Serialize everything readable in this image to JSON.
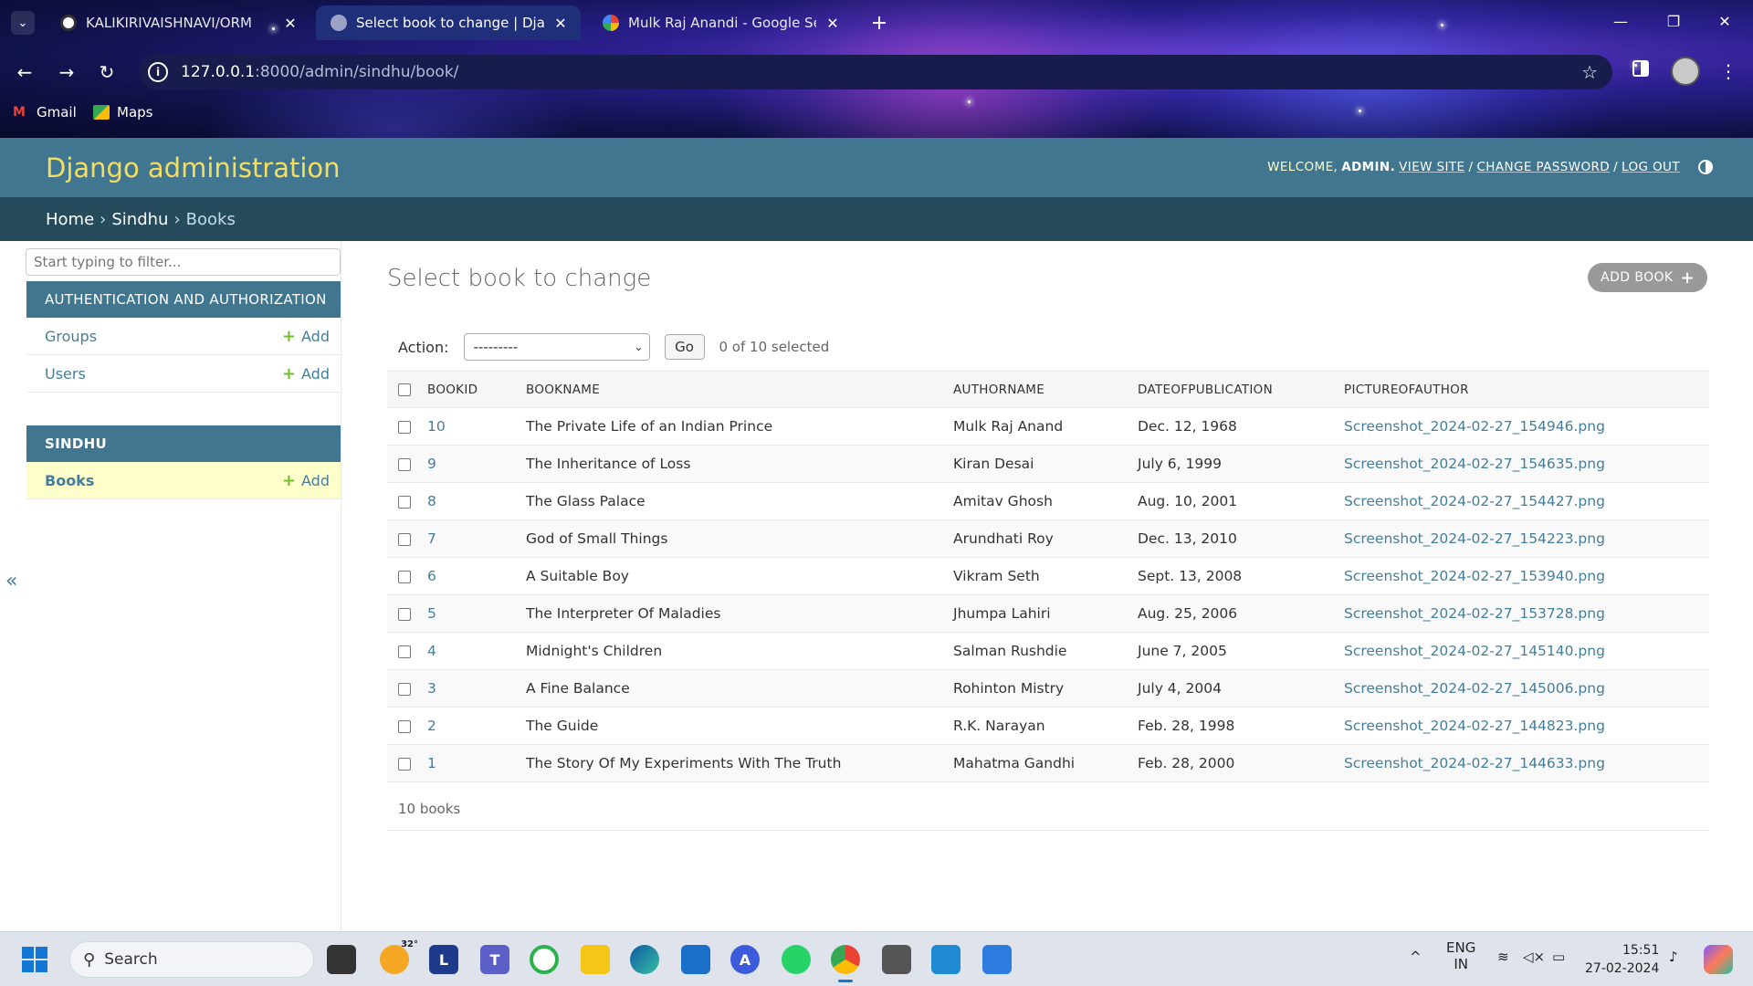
{
  "browser": {
    "tabs": [
      {
        "title": "KALIKIRIVAISHNAVI/ORM",
        "active": false,
        "icon": "github-icon"
      },
      {
        "title": "Select book to change | Django",
        "active": true,
        "icon": "globe-icon"
      },
      {
        "title": "Mulk Raj Anandi - Google Search",
        "active": false,
        "icon": "google-icon"
      }
    ],
    "url_host": "127.0.0.1",
    "url_rest": ":8000/admin/sindhu/book/",
    "bookmarks": [
      {
        "label": "Gmail",
        "icon": "gmail-icon"
      },
      {
        "label": "Maps",
        "icon": "maps-icon"
      }
    ]
  },
  "admin": {
    "branding": "Django administration",
    "welcome": "WELCOME,",
    "user": "ADMIN.",
    "view_site": "VIEW SITE",
    "change_password": "CHANGE PASSWORD",
    "log_out": "LOG OUT",
    "sep": "/",
    "breadcrumbs": [
      "Home",
      "Sindhu",
      "Books"
    ],
    "breadcrumb_sep": "›"
  },
  "sidebar": {
    "filter_placeholder": "Start typing to filter...",
    "apps": [
      {
        "name": "AUTHENTICATION AND AUTHORIZATION",
        "models": [
          {
            "name": "Groups",
            "add": "Add"
          },
          {
            "name": "Users",
            "add": "Add"
          }
        ]
      },
      {
        "name": "SINDHU",
        "models": [
          {
            "name": "Books",
            "add": "Add"
          }
        ]
      }
    ],
    "toggle": "«"
  },
  "content": {
    "title": "Select book to change",
    "add_button": "ADD BOOK",
    "action_label": "Action:",
    "action_selected": "---------",
    "go": "Go",
    "counter": "0 of 10 selected",
    "columns": [
      "BOOKID",
      "BOOKNAME",
      "AUTHORNAME",
      "DATEOFPUBLICATION",
      "PICTUREOFAUTHOR"
    ],
    "rows": [
      {
        "id": "10",
        "name": "The Private Life of an Indian Prince",
        "author": "Mulk Raj Anand",
        "date": "Dec. 12, 1968",
        "picture": "Screenshot_2024-02-27_154946.png"
      },
      {
        "id": "9",
        "name": "The Inheritance of Loss",
        "author": "Kiran Desai",
        "date": "July 6, 1999",
        "picture": "Screenshot_2024-02-27_154635.png"
      },
      {
        "id": "8",
        "name": "The Glass Palace",
        "author": "Amitav Ghosh",
        "date": "Aug. 10, 2001",
        "picture": "Screenshot_2024-02-27_154427.png"
      },
      {
        "id": "7",
        "name": "God of Small Things",
        "author": "Arundhati Roy",
        "date": "Dec. 13, 2010",
        "picture": "Screenshot_2024-02-27_154223.png"
      },
      {
        "id": "6",
        "name": "A Suitable Boy",
        "author": "Vikram Seth",
        "date": "Sept. 13, 2008",
        "picture": "Screenshot_2024-02-27_153940.png"
      },
      {
        "id": "5",
        "name": "The Interpreter Of Maladies",
        "author": "Jhumpa Lahiri",
        "date": "Aug. 25, 2006",
        "picture": "Screenshot_2024-02-27_153728.png"
      },
      {
        "id": "4",
        "name": "Midnight's Children",
        "author": "Salman Rushdie",
        "date": "June 7, 2005",
        "picture": "Screenshot_2024-02-27_145140.png"
      },
      {
        "id": "3",
        "name": "A Fine Balance",
        "author": "Rohinton Mistry",
        "date": "July 4, 2004",
        "picture": "Screenshot_2024-02-27_145006.png"
      },
      {
        "id": "2",
        "name": "The Guide",
        "author": "R.K. Narayan",
        "date": "Feb. 28, 1998",
        "picture": "Screenshot_2024-02-27_144823.png"
      },
      {
        "id": "1",
        "name": "The Story Of My Experiments With The Truth",
        "author": "Mahatma Gandhi",
        "date": "Feb. 28, 2000",
        "picture": "Screenshot_2024-02-27_144633.png"
      }
    ],
    "paginator": "10 books"
  },
  "taskbar": {
    "search": "Search",
    "weather": "32°",
    "lang1": "ENG",
    "lang2": "IN",
    "time": "15:51",
    "date": "27-02-2024"
  },
  "colors": {
    "header": "#417690",
    "breadcrumbs": "#264b5d",
    "branding": "#f5dd5d",
    "link": "#447e9b",
    "add_plus": "#70bf2b"
  }
}
